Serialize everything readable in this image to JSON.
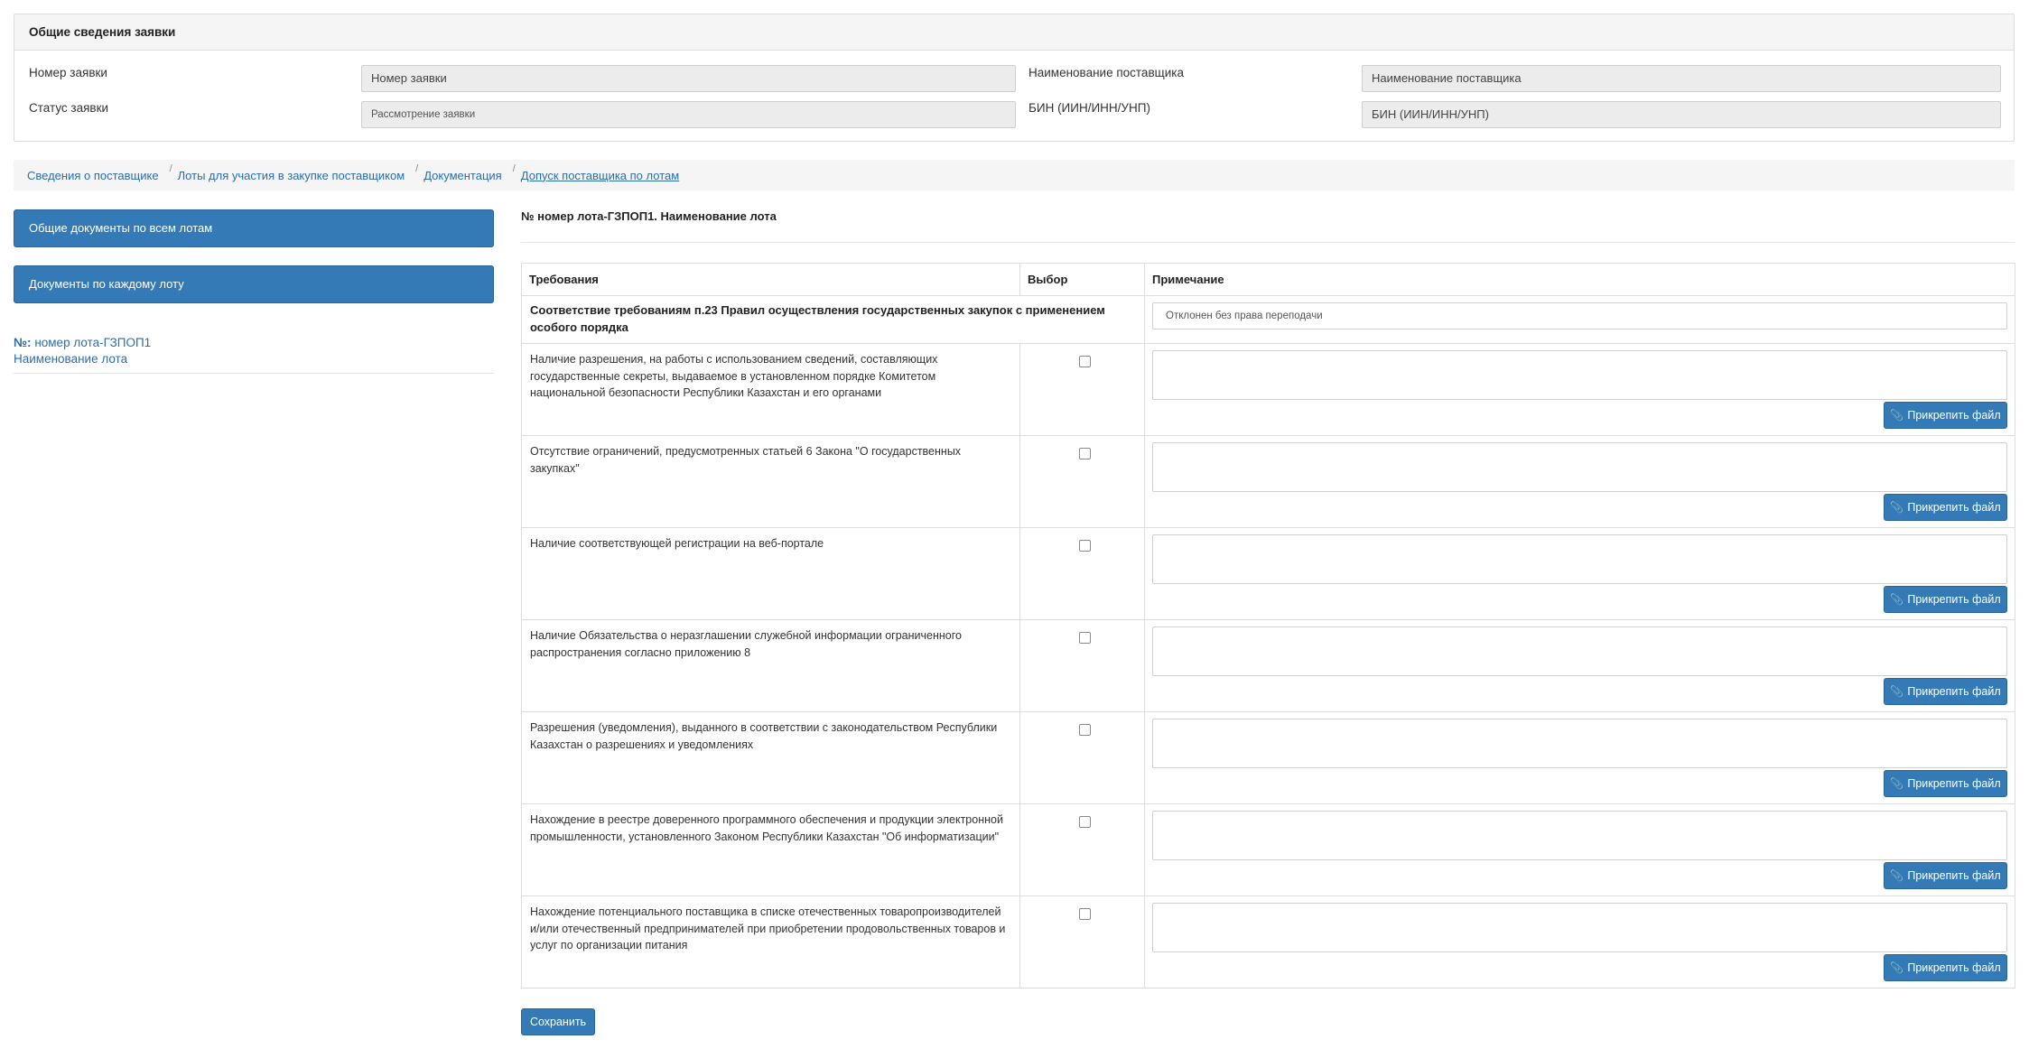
{
  "general": {
    "title": "Общие сведения заявки",
    "fields": {
      "app_number_label": "Номер заявки",
      "app_number_value": "Номер заявки",
      "supplier_name_label": "Наименование поставщика",
      "supplier_name_value": "Наименование поставщика",
      "status_label": "Статус заявки",
      "status_value": "Рассмотрение заявки",
      "bin_label": "БИН (ИИН/ИНН/УНП)",
      "bin_value": "БИН (ИИН/ИНН/УНП)"
    }
  },
  "breadcrumb": {
    "items": [
      "Сведения о поставщике",
      "Лоты для участия в закупке поставщиком",
      "Документация",
      "Допуск поставщика по лотам"
    ],
    "separator": "/"
  },
  "sidebar": {
    "btn_all_docs": "Общие документы по всем лотам",
    "btn_each_lot": "Документы по каждому лоту",
    "lot_prefix": "№:",
    "lot_number": "номер лота-ГЗПОП1",
    "lot_name": "Наименование лота"
  },
  "main": {
    "lot_title": "№ номер лота-ГЗПОП1. Наименование лота",
    "table": {
      "headers": [
        "Требования",
        "Выбор",
        "Примечание"
      ],
      "first_row": {
        "text": "Соответствие требованиям п.23 Правил осуществления государственных закупок с применением особого порядка",
        "note": "Отклонен без права переподачи"
      },
      "rows": [
        "Наличие разрешения, на работы с использованием сведений, составляющих государственные секреты, выдаваемое в установленном порядке Комитетом национальной безопасности Республики Казахстан и его органами",
        "Отсутствие ограничений, предусмотренных статьей 6 Закона \"О государственных закупках\"",
        "Наличие соответствующей регистрации на веб-портале",
        "Наличие Обязательства о неразглашении служебной информации ограниченного распространения согласно приложению 8",
        "Разрешения (уведомления), выданного в соответствии с законодательством Республики Казахстан о разрешениях и уведомлениях",
        "Нахождение в реестре доверенного программного обеспечения и продукции электронной промышленности, установленного Законом Республики Казахстан \"Об информатизации\"",
        "Нахождение потенциального поставщика в списке отечественных товаропроизводителей и/или отечественный предпринимателей при приобретении продовольственных товаров и услуг по организации питания"
      ],
      "attach_label": "Прикрепить файл"
    },
    "save_label": "Сохранить"
  },
  "icons": {
    "attach": "paperclip-icon"
  },
  "colors": {
    "primary": "#337ab7",
    "link": "#2a6db0",
    "panel_bg": "#f5f5f5"
  }
}
